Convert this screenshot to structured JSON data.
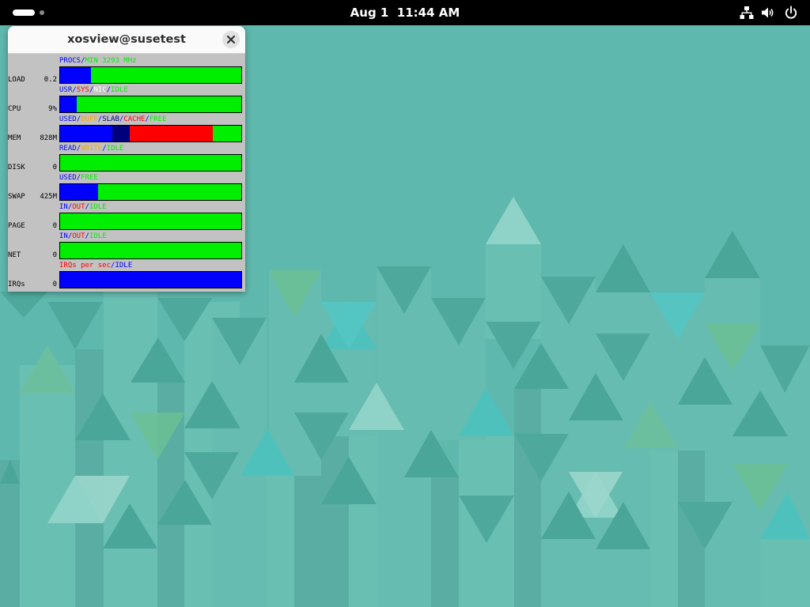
{
  "topbar": {
    "clock": "Aug 1  11:44 AM",
    "icons": [
      "workspace-indicator",
      "network-icon",
      "volume-icon",
      "power-icon"
    ]
  },
  "window": {
    "title": "xosview@susetest",
    "close_icon": "close-icon"
  },
  "colors": {
    "blue": "#0000ff",
    "navy": "#00007f",
    "red": "#ff0000",
    "green": "#00ee00",
    "orange": "#ffa500",
    "white": "#ffffff",
    "wallpaper": "#5fb8ad"
  },
  "meters": [
    {
      "label": "LOAD",
      "value": "0.2",
      "legend": [
        {
          "text": "PROCS",
          "color": "#0000ff"
        },
        {
          "text": "MIN 3293 MHz",
          "color": "#00ee00"
        }
      ],
      "segments": [
        {
          "frac": 0.17,
          "color": "#0000ff"
        },
        {
          "frac": 0.83,
          "color": "#00ee00"
        }
      ]
    },
    {
      "label": "CPU",
      "value": "9%",
      "legend": [
        {
          "text": "USR",
          "color": "#0000ff"
        },
        {
          "text": "SYS",
          "color": "#ff0000"
        },
        {
          "text": "NIC",
          "color": "#ffffff"
        },
        {
          "text": "IDLE",
          "color": "#00ee00"
        }
      ],
      "segments": [
        {
          "frac": 0.09,
          "color": "#0000ff"
        },
        {
          "frac": 0.91,
          "color": "#00ee00"
        }
      ]
    },
    {
      "label": "MEM",
      "value": "828M",
      "legend": [
        {
          "text": "USED",
          "color": "#0000ff"
        },
        {
          "text": "BUFF",
          "color": "#ffa500"
        },
        {
          "text": "SLAB",
          "color": "#00007f"
        },
        {
          "text": "CACHE",
          "color": "#ff0000"
        },
        {
          "text": "FREE",
          "color": "#00ee00"
        }
      ],
      "segments": [
        {
          "frac": 0.29,
          "color": "#0000ff"
        },
        {
          "frac": 0.095,
          "color": "#00007f"
        },
        {
          "frac": 0.46,
          "color": "#ff0000"
        },
        {
          "frac": 0.155,
          "color": "#00ee00"
        }
      ]
    },
    {
      "label": "DISK",
      "value": "0",
      "legend": [
        {
          "text": "READ",
          "color": "#0000ff"
        },
        {
          "text": "WRITE",
          "color": "#ffa500"
        },
        {
          "text": "IDLE",
          "color": "#00ee00"
        }
      ],
      "segments": [
        {
          "frac": 1.0,
          "color": "#00ee00"
        }
      ]
    },
    {
      "label": "SWAP",
      "value": "425M",
      "legend": [
        {
          "text": "USED",
          "color": "#0000ff"
        },
        {
          "text": "FREE",
          "color": "#00ee00"
        }
      ],
      "segments": [
        {
          "frac": 0.21,
          "color": "#0000ff"
        },
        {
          "frac": 0.79,
          "color": "#00ee00"
        }
      ]
    },
    {
      "label": "PAGE",
      "value": "0",
      "legend": [
        {
          "text": "IN",
          "color": "#0000ff"
        },
        {
          "text": "OUT",
          "color": "#ff0000"
        },
        {
          "text": "IDLE",
          "color": "#00ee00"
        }
      ],
      "segments": [
        {
          "frac": 1.0,
          "color": "#00ee00"
        }
      ]
    },
    {
      "label": "NET",
      "value": "0",
      "legend": [
        {
          "text": "IN",
          "color": "#0000ff"
        },
        {
          "text": "OUT",
          "color": "#ff0000"
        },
        {
          "text": "IDLE",
          "color": "#00ee00"
        }
      ],
      "segments": [
        {
          "frac": 1.0,
          "color": "#00ee00"
        }
      ]
    },
    {
      "label": "IRQs",
      "value": "0",
      "legend": [
        {
          "text": "IRQs per sec",
          "color": "#ff0000"
        },
        {
          "text": "IDLE",
          "color": "#0000ff"
        }
      ],
      "segments": [
        {
          "frac": 1.0,
          "color": "#0000ff"
        }
      ]
    }
  ]
}
